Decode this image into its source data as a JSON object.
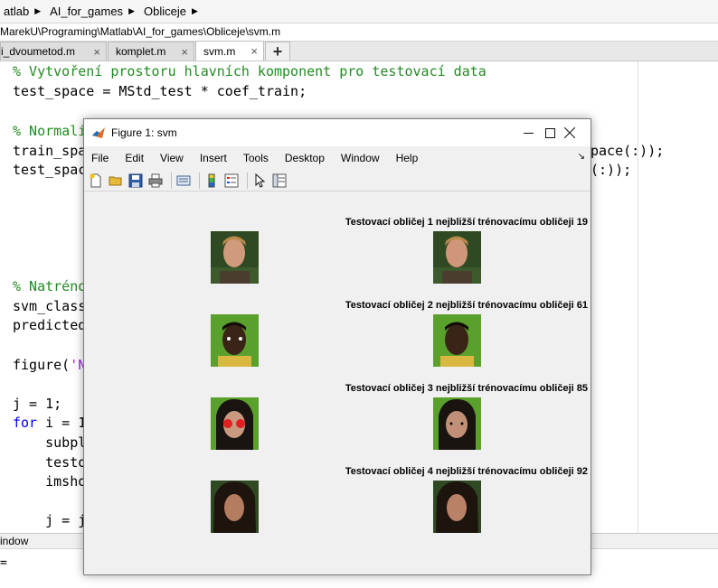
{
  "breadcrumb": [
    "atlab",
    "AI_for_games",
    "Obliceje"
  ],
  "path": "MarekU\\Programing\\Matlab\\AI_for_games\\Obliceje\\svm.m",
  "tabs": [
    {
      "label": "i_dvoumetod.m",
      "close": "×"
    },
    {
      "label": "komplet.m",
      "close": "×"
    },
    {
      "label": "svm.m",
      "close": "×"
    }
  ],
  "tab_add": "+",
  "code": {
    "l1": "% Vytvoření prostoru hlavních komponent pro testovací data",
    "l2": "test_space = MStd_test * coef_train;",
    "l3": "% Normali",
    "l4a": "train_spa",
    "l4b": "pace(:));",
    "l5a": "test_spac",
    "l5b": "(:));",
    "l6": "% Natréno",
    "l7": "svm_class",
    "l8": "predicted",
    "l9a": "figure(",
    "l9b": "'N",
    "l10": "j = 1;",
    "l11a": "for",
    "l11b": " i = 1",
    "l12": "    subpl",
    "l13": "    testo",
    "l14": "    imsho",
    "l15": "    j = j"
  },
  "command_window": {
    "title": "indow",
    "prompt": "="
  },
  "figure": {
    "title": "Figure 1: svm",
    "menus": [
      "File",
      "Edit",
      "View",
      "Insert",
      "Tools",
      "Desktop",
      "Window",
      "Help"
    ],
    "dock_glyph": "↘",
    "toolbar_icons": [
      "new-figure-icon",
      "open-icon",
      "save-icon",
      "print-icon",
      "link-icon",
      "colorbar-icon",
      "legend-icon",
      "pointer-icon",
      "property-editor-icon"
    ],
    "subplot_titles": [
      "Testovací obličej 1 nejbližší trénovacímu obličeji 19",
      "Testovací obličej 2 nejbližší trénovacímu obličeji 61",
      "Testovací obličej 3 nejbližší trénovacímu obličeji 85",
      "Testovací obličej 4 nejbližší trénovacímu obličeji 92"
    ]
  },
  "colors": {
    "comment": "#228b22",
    "keyword": "#0000ff",
    "string": "#a020f0",
    "face_bg_green": "#5aa02c",
    "face_bg_dark": "#2f4a22"
  }
}
